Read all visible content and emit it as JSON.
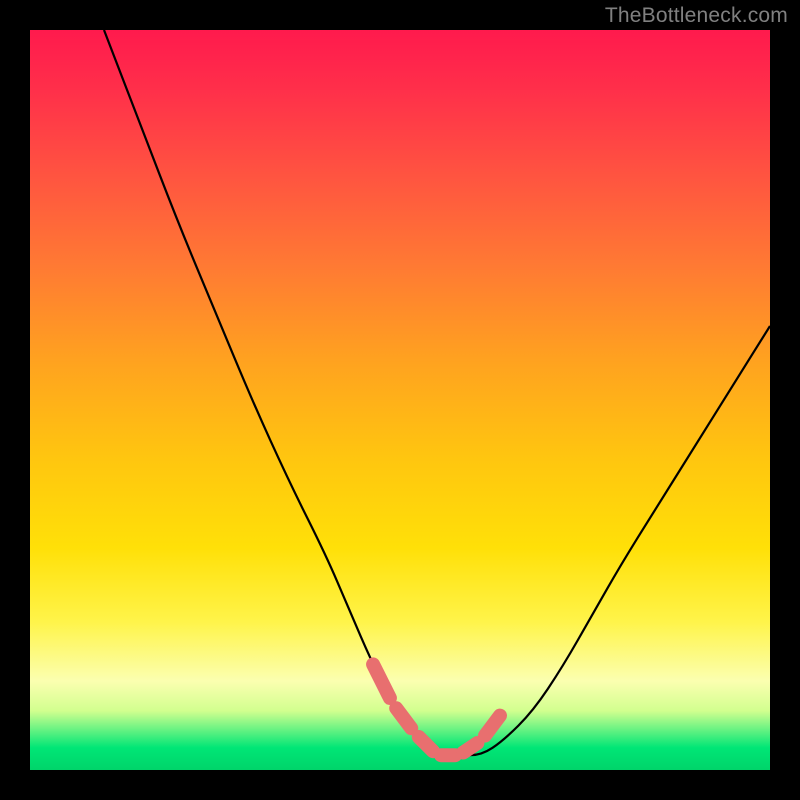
{
  "watermark": "TheBottleneck.com",
  "colors": {
    "frame": "#000000",
    "curve": "#000000",
    "segmented_stroke": "#e86f6f",
    "gradient_stops": [
      "#ff1a4d",
      "#ff5540",
      "#ffa31f",
      "#ffe008",
      "#fbffb0",
      "#00e676"
    ]
  },
  "chart_data": {
    "type": "line",
    "title": "",
    "xlabel": "",
    "ylabel": "",
    "xlim": [
      0,
      100
    ],
    "ylim": [
      0,
      100
    ],
    "grid": false,
    "legend": false,
    "axes_visible": false,
    "series": [
      {
        "name": "bottleneck-curve",
        "x": [
          10,
          15,
          20,
          25,
          30,
          35,
          40,
          43,
          46,
          49,
          52,
          55,
          58,
          61,
          64,
          68,
          72,
          76,
          80,
          85,
          90,
          95,
          100
        ],
        "values": [
          100,
          87,
          74,
          62,
          50,
          39,
          29,
          22,
          15,
          9,
          5,
          2,
          2,
          2,
          4,
          8,
          14,
          21,
          28,
          36,
          44,
          52,
          60
        ]
      }
    ],
    "annotations": [
      {
        "name": "highlighted-minimum-segment",
        "style": "segmented-pink",
        "points_x": [
          46,
          49,
          52,
          55,
          58,
          61,
          64
        ],
        "points_y": [
          15,
          9,
          5,
          2,
          2,
          4,
          8
        ]
      }
    ],
    "background": {
      "type": "vertical-gradient",
      "meaning": "high-value-red-to-low-value-green",
      "stops": [
        {
          "pos": 0.0,
          "color": "#ff1a4d"
        },
        {
          "pos": 0.45,
          "color": "#ffa31f"
        },
        {
          "pos": 0.8,
          "color": "#fff44a"
        },
        {
          "pos": 0.97,
          "color": "#00e676"
        }
      ]
    }
  }
}
